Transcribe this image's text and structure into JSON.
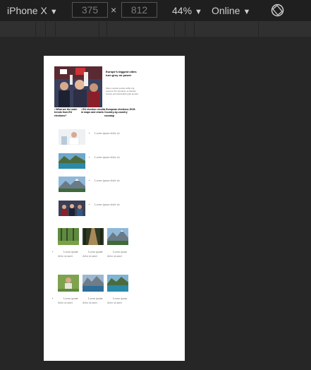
{
  "toolbar": {
    "device": "iPhone X",
    "width": "375",
    "height": "812",
    "times": "×",
    "zoom": "44%",
    "network": "Online"
  },
  "page": {
    "hero": {
      "title": "Europe's biggest cities turn grey on power",
      "description": "Major centrist parties suffer big losses in EU elections, as liberals, Greens and nationalists gain ground"
    },
    "headlines": [
      "• What are the main trends from EU elections?",
      "• EU election results in maps and charts",
      "• European elections 2019: Country-by-country roundup"
    ],
    "list_items": [
      {
        "image": "doctor-photo",
        "text": "Lorem ipsum dolor sit"
      },
      {
        "image": "lake-photo",
        "text": "Lorem ipsum dolor sit"
      },
      {
        "image": "mountain-photo",
        "text": "Lorem ipsum dolor sit"
      },
      {
        "image": "crowd-photo",
        "text": "Lorem ipsum dolor sit"
      }
    ],
    "grid_rows": [
      [
        {
          "image": "forest-photo",
          "text": "Lorem ipsum dolor sit amet"
        },
        {
          "image": "forest-path-photo",
          "text": "Lorem ipsum dolor sit amet"
        },
        {
          "image": "mountain-photo",
          "text": "Lorem ipsum dolor sit amet"
        }
      ],
      [
        {
          "image": "person-photo",
          "text": "Lorem ipsum dolor sit amet"
        },
        {
          "image": "mountain-lake-photo",
          "text": "Lorem ipsum dolor sit amet"
        },
        {
          "image": "lake-photo",
          "text": "Lorem ipsum dolor sit amet"
        }
      ]
    ]
  }
}
